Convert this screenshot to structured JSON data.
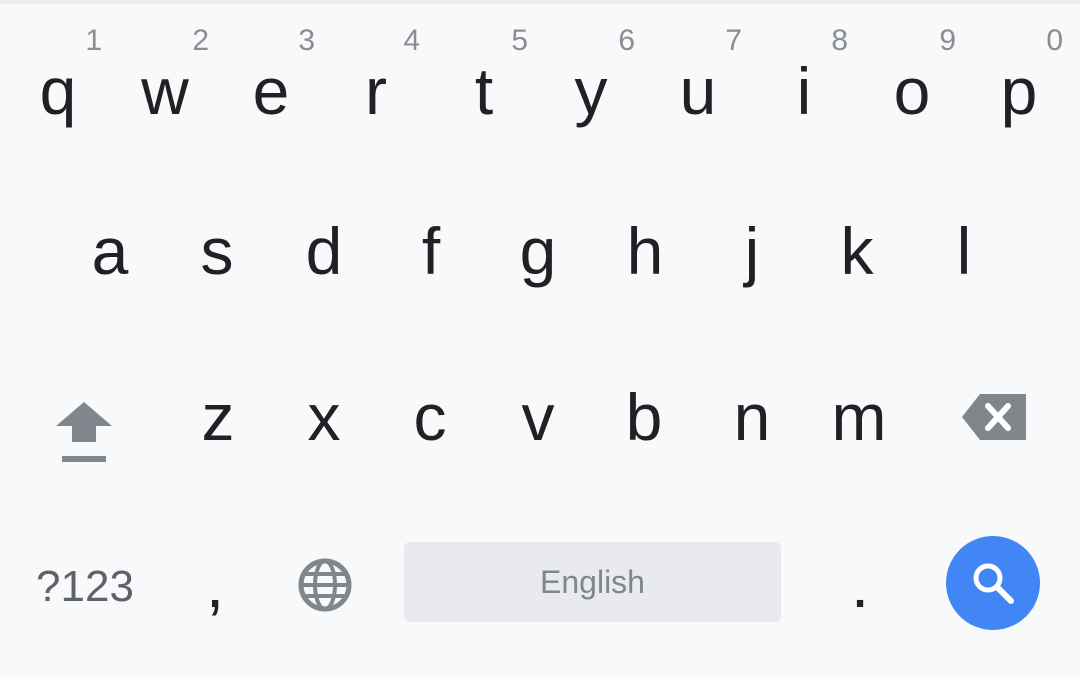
{
  "keyboard": {
    "row1": [
      {
        "letter": "q",
        "hint": "1"
      },
      {
        "letter": "w",
        "hint": "2"
      },
      {
        "letter": "e",
        "hint": "3"
      },
      {
        "letter": "r",
        "hint": "4"
      },
      {
        "letter": "t",
        "hint": "5"
      },
      {
        "letter": "y",
        "hint": "6"
      },
      {
        "letter": "u",
        "hint": "7"
      },
      {
        "letter": "i",
        "hint": "8"
      },
      {
        "letter": "o",
        "hint": "9"
      },
      {
        "letter": "p",
        "hint": "0"
      }
    ],
    "row2": [
      "a",
      "s",
      "d",
      "f",
      "g",
      "h",
      "j",
      "k",
      "l"
    ],
    "row3": [
      "z",
      "x",
      "c",
      "v",
      "b",
      "n",
      "m"
    ],
    "bottom": {
      "symbols_label": "?123",
      "comma_label": ",",
      "space_label": "English",
      "period_label": "."
    },
    "icons": {
      "shift": "shift-icon",
      "backspace": "backspace-icon",
      "globe": "globe-icon",
      "search": "search-icon"
    },
    "colors": {
      "background": "#f8f9fa",
      "key_text": "#202124",
      "hint_text": "#8a8d91",
      "icon_gray": "#80868b",
      "space_bar": "#e8eaed",
      "search_button": "#4285f4"
    }
  }
}
